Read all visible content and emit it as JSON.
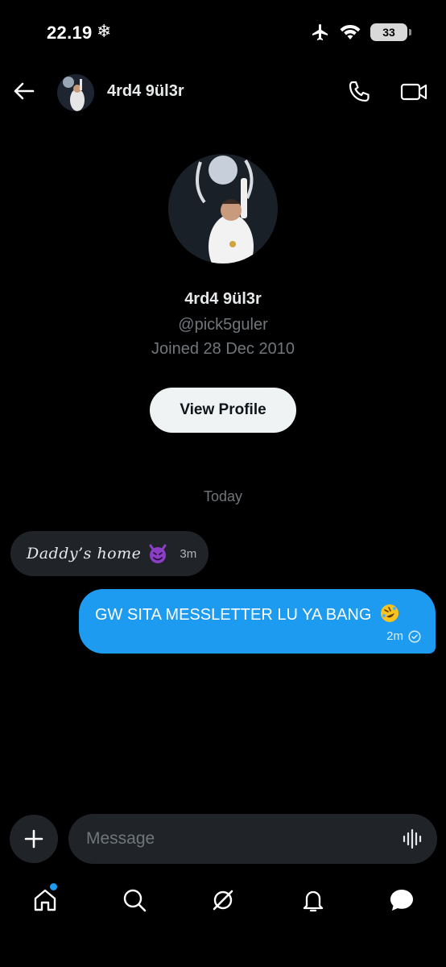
{
  "status_bar": {
    "time": "22.19",
    "weather_icon": "snowflake-icon",
    "battery": "33",
    "icons": [
      "airplane-icon",
      "wifi-icon",
      "battery-icon"
    ]
  },
  "header": {
    "name": "4rd4 9ül3r",
    "back_icon": "back-arrow-icon",
    "call_icon": "phone-icon",
    "video_icon": "video-camera-icon"
  },
  "profile": {
    "name": "4rd4 9ül3r",
    "handle": "@pick5guler",
    "joined": "Joined 28 Dec 2010",
    "view_profile_label": "View Profile"
  },
  "conversation": {
    "day_separator": "Today",
    "messages": [
      {
        "direction": "incoming",
        "text": "Daddy’s home",
        "emoji": "😈",
        "time": "3m"
      },
      {
        "direction": "outgoing",
        "text": "GW SITA MESSLETTER LU YA BANG",
        "emoji": "🤣",
        "time": "2m",
        "status": "sent"
      }
    ]
  },
  "composer": {
    "placeholder": "Message",
    "add_icon": "plus-icon",
    "voice_icon": "voice-waveform-icon"
  },
  "bottom_nav": {
    "items": [
      "home-icon",
      "search-icon",
      "grok-icon",
      "notifications-icon",
      "messages-icon"
    ],
    "home_has_badge": true
  },
  "colors": {
    "background": "#000000",
    "accent": "#1d9bf0",
    "bubble_incoming": "#202327",
    "muted_text": "#71767b"
  }
}
